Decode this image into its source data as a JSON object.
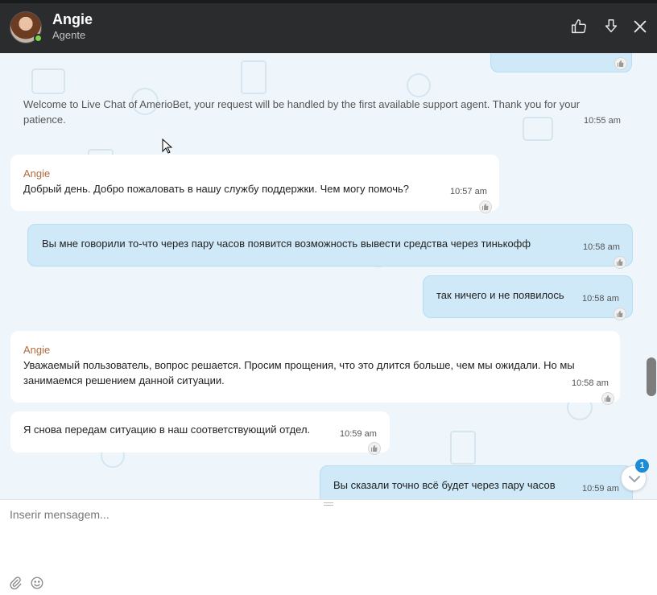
{
  "header": {
    "agent_name": "Angie",
    "agent_role": "Agente",
    "status_color": "#7bd34a",
    "actions": [
      {
        "name": "thumbs-up-button",
        "icon": "thumbs-up-icon"
      },
      {
        "name": "download-button",
        "icon": "download-icon"
      },
      {
        "name": "close-button",
        "icon": "close-icon"
      }
    ]
  },
  "system_message": {
    "text": "Welcome to Live Chat of AmerioBet, your request will be handled by the first available support agent. Thank you for your patience.",
    "time": "10:55 am"
  },
  "top_partial_time": "10:55 am",
  "messages": [
    {
      "from": "agent",
      "sender": "Angie",
      "text": "Добрый день. Добро пожаловать в нашу службу поддержки. Чем могу помочь?",
      "time": "10:57 am"
    },
    {
      "from": "user",
      "text": "Вы мне говорили то-что через пару часов появится возможность вывести средства через тинькофф",
      "time": "10:58 am"
    },
    {
      "from": "user",
      "text": "так ничего и не появилось",
      "time": "10:58 am"
    },
    {
      "from": "agent",
      "sender": "Angie",
      "text": "Уважаемый пользователь, вопрос решается. Просим прощения, что это длится больше, чем мы ожидали. Но мы занимаемся решением данной ситуации.",
      "time": "10:58 am"
    },
    {
      "from": "agent",
      "text": "Я снова передам ситуацию в наш соответствующий отдел.",
      "time": "10:59 am"
    },
    {
      "from": "user",
      "text": "Вы сказали точно всё будет через пару часов",
      "time": "10:59 am"
    }
  ],
  "unread_count": "1",
  "composer": {
    "placeholder": "Inserir mensagem...",
    "attach_icon": "paperclip-icon",
    "emoji_icon": "smiley-icon"
  },
  "colors": {
    "header_bg": "#2b2c2e",
    "chat_bg": "#eef6fb",
    "user_bubble": "#cfe9f8",
    "agent_bubble": "#ffffff",
    "sender_name": "#b06b3e",
    "badge": "#1d8cd8"
  }
}
